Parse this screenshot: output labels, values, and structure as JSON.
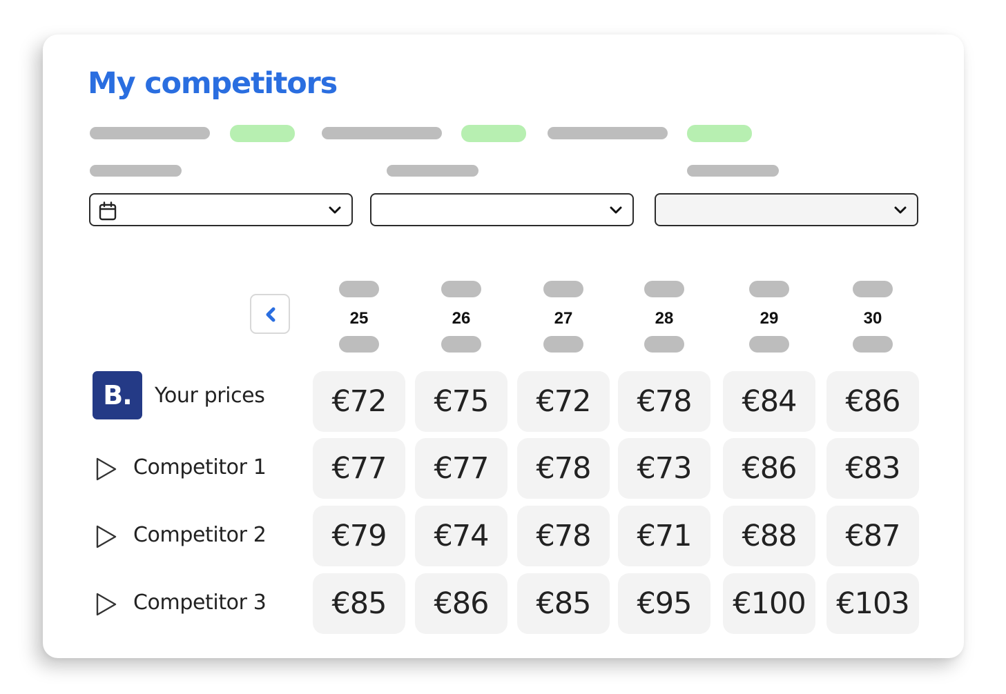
{
  "header": {
    "title": "My competitors"
  },
  "calendar": {
    "prev_icon": "chevron-left-icon",
    "accent": "#2a6ee0"
  },
  "days": [
    "25",
    "26",
    "27",
    "28",
    "29",
    "30"
  ],
  "rows": [
    {
      "label": "Your prices",
      "icon": "booking-logo",
      "prices": [
        "€72",
        "€75",
        "€72",
        "€78",
        "€84",
        "€86"
      ]
    },
    {
      "label": "Competitor 1",
      "icon": "play-icon",
      "prices": [
        "€77",
        "€77",
        "€78",
        "€73",
        "€86",
        "€83"
      ]
    },
    {
      "label": "Competitor 2",
      "icon": "play-icon",
      "prices": [
        "€79",
        "€74",
        "€78",
        "€71",
        "€88",
        "€87"
      ]
    },
    {
      "label": "Competitor 3",
      "icon": "play-icon",
      "prices": [
        "€85",
        "€86",
        "€85",
        "€95",
        "€100",
        "€103"
      ]
    }
  ],
  "logo_text": "B.",
  "colors": {
    "title": "#2a6ee0",
    "logo_bg": "#243a86",
    "placeholder": "#bdbdbd",
    "placeholder_accent": "#b7efb1",
    "cell_bg": "#f3f3f3"
  }
}
